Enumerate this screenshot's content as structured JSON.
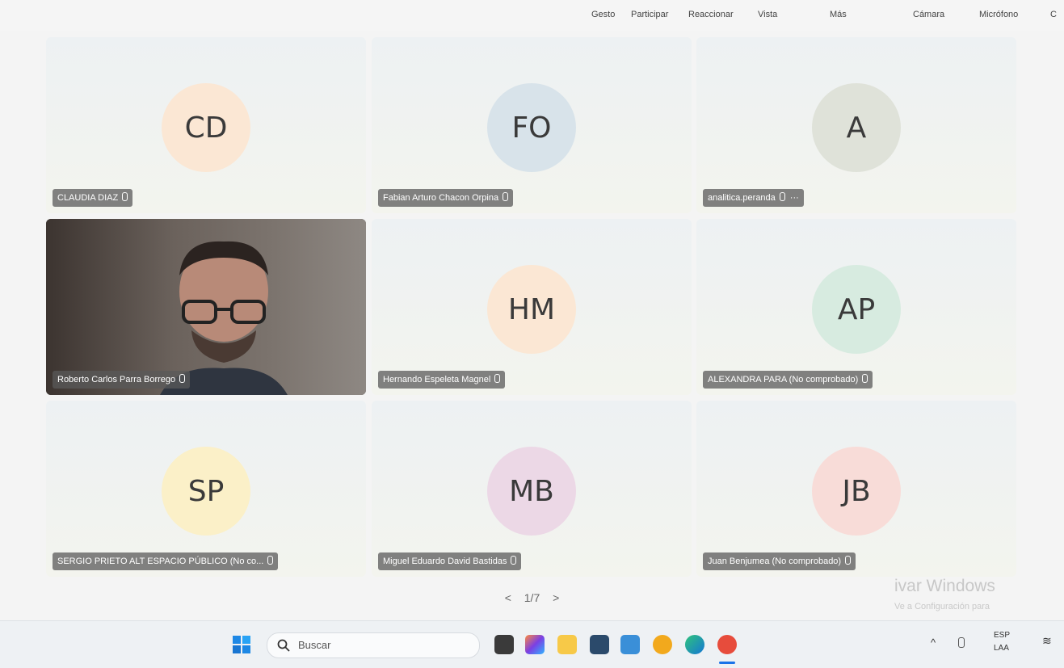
{
  "toolbar": {
    "items": [
      "Gesto",
      "Participar",
      "Reaccionar",
      "Vista",
      "Más",
      "Cámara",
      "Micrófono",
      "C"
    ]
  },
  "participants": [
    {
      "initials": "CD",
      "name": "CLAUDIA DIAZ",
      "color": "#fbe7d4"
    },
    {
      "initials": "FO",
      "name": "Fabian Arturo Chacon Orpina",
      "color": "#d8e3ea"
    },
    {
      "initials": "A",
      "name": "analitica.peranda",
      "color": "#dfe2d9",
      "more": "···"
    },
    {
      "initials": "",
      "name": "Roberto Carlos Parra Borrego",
      "video": true
    },
    {
      "initials": "HM",
      "name": "Hernando Espeleta Magnel",
      "color": "#fbe7d4"
    },
    {
      "initials": "AP",
      "name": "ALEXANDRA PARA (No comprobado)",
      "color": "#d7ebe0"
    },
    {
      "initials": "SP",
      "name": "SERGIO PRIETO ALT ESPACIO PÚBLICO (No co...",
      "color": "#fbf0c8"
    },
    {
      "initials": "MB",
      "name": "Miguel Eduardo David Bastidas",
      "color": "#ecd8e6"
    },
    {
      "initials": "JB",
      "name": "Juan Benjumea (No comprobado)",
      "color": "#f8dcd8"
    }
  ],
  "pager": {
    "prev": "<",
    "label": "1/7",
    "next": ">"
  },
  "watermark": {
    "line1": "ivar Windows",
    "line2": "Ve a Configuración para"
  },
  "taskbar": {
    "search_placeholder": "Buscar",
    "tray_lang1": "ESP",
    "tray_lang2": "LAA",
    "chevron": "^"
  }
}
